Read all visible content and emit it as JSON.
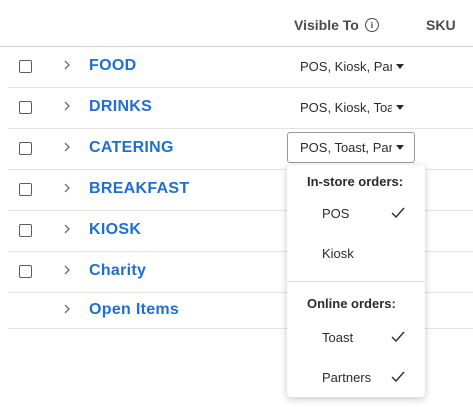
{
  "header": {
    "visible_to_label": "Visible To",
    "sku_label": "SKU",
    "info_icon": "info-icon"
  },
  "categories": [
    {
      "label": "FOOD",
      "visible_to": "POS, Kiosk, Partners",
      "has_checkbox": true
    },
    {
      "label": "DRINKS",
      "visible_to": "POS, Kiosk, Toast",
      "has_checkbox": true
    },
    {
      "label": "CATERING",
      "visible_to": "POS, Toast, Partners",
      "has_checkbox": true,
      "dropdown_open": true
    },
    {
      "label": "BREAKFAST",
      "has_checkbox": true
    },
    {
      "label": "KIOSK",
      "has_checkbox": true
    },
    {
      "label": "Charity",
      "has_checkbox": true
    },
    {
      "label": "Open Items",
      "has_checkbox": false
    }
  ],
  "dropdown": {
    "sections": [
      {
        "title": "In-store orders:",
        "options": [
          {
            "label": "POS",
            "checked": true
          },
          {
            "label": "Kiosk",
            "checked": false
          }
        ]
      },
      {
        "title": "Online orders:",
        "options": [
          {
            "label": "Toast",
            "checked": true
          },
          {
            "label": "Partners",
            "checked": true
          }
        ]
      }
    ]
  },
  "colors": {
    "category_link": "#1f6fd1",
    "divider": "#e3e3e3"
  }
}
